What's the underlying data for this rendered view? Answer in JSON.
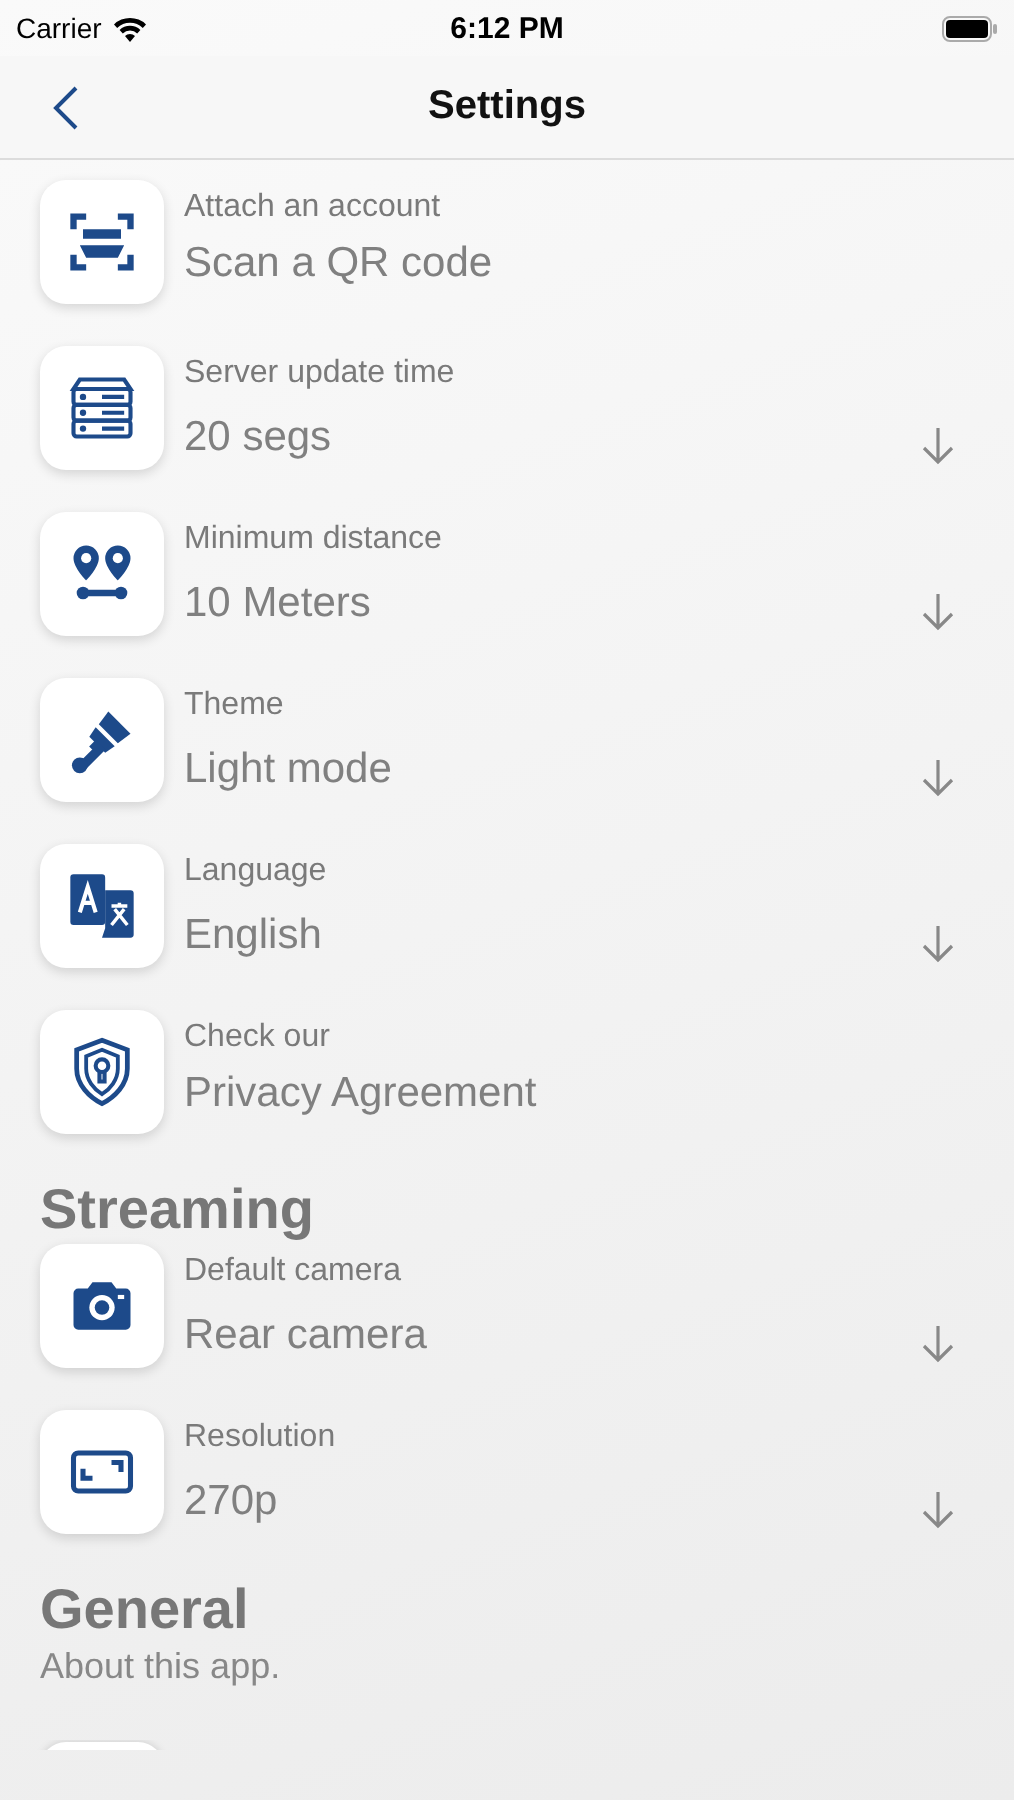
{
  "status_bar": {
    "carrier": "Carrier",
    "time": "6:12 PM"
  },
  "nav": {
    "title": "Settings"
  },
  "sections": [
    {
      "rows": [
        {
          "kind": "link",
          "label": "Attach an account",
          "value": "Scan a QR code"
        },
        {
          "kind": "picker",
          "label": "Server update time",
          "value": "20 segs"
        },
        {
          "kind": "picker",
          "label": "Minimum distance",
          "value": "10 Meters"
        },
        {
          "kind": "picker",
          "label": "Theme",
          "value": "Light mode"
        },
        {
          "kind": "picker",
          "label": "Language",
          "value": "English"
        },
        {
          "kind": "link",
          "label": "Check our",
          "value": "Privacy Agreement"
        }
      ]
    },
    {
      "title": "Streaming",
      "rows": [
        {
          "kind": "picker",
          "label": "Default camera",
          "value": "Rear camera"
        },
        {
          "kind": "picker",
          "label": "Resolution",
          "value": "270p"
        }
      ]
    },
    {
      "title": "General",
      "subtitle": "About this app."
    }
  ]
}
